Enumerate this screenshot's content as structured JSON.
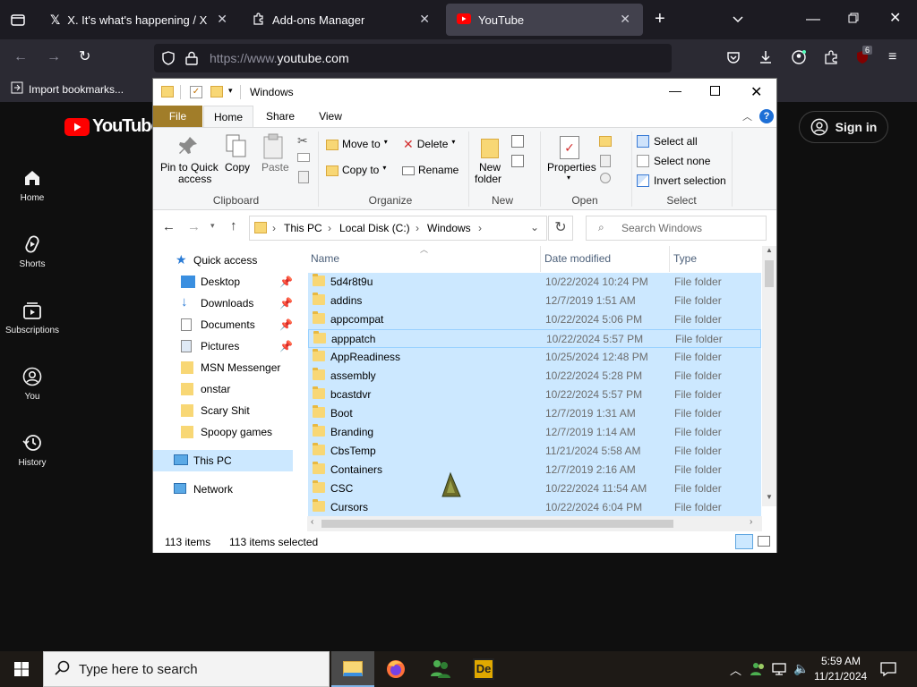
{
  "browser": {
    "tabs": [
      {
        "label": "X. It's what's happening / X"
      },
      {
        "label": "Add-ons Manager"
      },
      {
        "label": "YouTube"
      }
    ],
    "url_scheme": "https://www.",
    "url_host": "youtube.com",
    "bookmark": "Import bookmarks...",
    "ext_badge": "6"
  },
  "youtube": {
    "logo": "YouTube",
    "sidebar": [
      {
        "label": "Home"
      },
      {
        "label": "Shorts"
      },
      {
        "label": "Subscriptions"
      },
      {
        "label": "You"
      },
      {
        "label": "History"
      }
    ],
    "signin": "Sign in"
  },
  "explorer": {
    "title": "Windows",
    "ribbon_tabs": [
      "File",
      "Home",
      "Share",
      "View"
    ],
    "ribbon": {
      "pin": "Pin to Quick access",
      "pin_l1": "Pin to Quick",
      "pin_l2": "access",
      "copy": "Copy",
      "paste": "Paste",
      "move_to": "Move to",
      "copy_to": "Copy to",
      "delete": "Delete",
      "rename": "Rename",
      "new_folder_l1": "New",
      "new_folder_l2": "folder",
      "properties": "Properties",
      "select_all": "Select all",
      "select_none": "Select none",
      "invert": "Invert selection",
      "groups": {
        "clipboard": "Clipboard",
        "organize": "Organize",
        "new": "New",
        "open": "Open",
        "select": "Select"
      }
    },
    "breadcrumb": [
      "This PC",
      "Local Disk (C:)",
      "Windows"
    ],
    "search_placeholder": "Search Windows",
    "nav": [
      {
        "label": "Quick access"
      },
      {
        "label": "Desktop"
      },
      {
        "label": "Downloads"
      },
      {
        "label": "Documents"
      },
      {
        "label": "Pictures"
      },
      {
        "label": "MSN Messenger"
      },
      {
        "label": "onstar"
      },
      {
        "label": "Scary Shit"
      },
      {
        "label": "Spoopy games"
      },
      {
        "label": "This PC"
      },
      {
        "label": "Network"
      }
    ],
    "columns": {
      "name": "Name",
      "date": "Date modified",
      "type": "Type"
    },
    "rows": [
      {
        "name": "5d4r8t9u",
        "date": "10/22/2024 10:24 PM",
        "type": "File folder"
      },
      {
        "name": "addins",
        "date": "12/7/2019 1:51 AM",
        "type": "File folder"
      },
      {
        "name": "appcompat",
        "date": "10/22/2024 5:06 PM",
        "type": "File folder"
      },
      {
        "name": "apppatch",
        "date": "10/22/2024 5:57 PM",
        "type": "File folder"
      },
      {
        "name": "AppReadiness",
        "date": "10/25/2024 12:48 PM",
        "type": "File folder"
      },
      {
        "name": "assembly",
        "date": "10/22/2024 5:28 PM",
        "type": "File folder"
      },
      {
        "name": "bcastdvr",
        "date": "10/22/2024 5:57 PM",
        "type": "File folder"
      },
      {
        "name": "Boot",
        "date": "12/7/2019 1:31 AM",
        "type": "File folder"
      },
      {
        "name": "Branding",
        "date": "12/7/2019 1:14 AM",
        "type": "File folder"
      },
      {
        "name": "CbsTemp",
        "date": "11/21/2024 5:58 AM",
        "type": "File folder"
      },
      {
        "name": "Containers",
        "date": "12/7/2019 2:16 AM",
        "type": "File folder"
      },
      {
        "name": "CSC",
        "date": "10/22/2024 11:54 AM",
        "type": "File folder"
      },
      {
        "name": "Cursors",
        "date": "10/22/2024 6:04 PM",
        "type": "File folder"
      }
    ],
    "status": {
      "items": "113 items",
      "selected": "113 items selected"
    }
  },
  "taskbar": {
    "search_placeholder": "Type here to search",
    "time": "5:59 AM",
    "date": "11/21/2024"
  },
  "colors": {
    "accent_red": "#ff0000",
    "selection": "#cce8ff",
    "file_tab": "#a17d29"
  }
}
